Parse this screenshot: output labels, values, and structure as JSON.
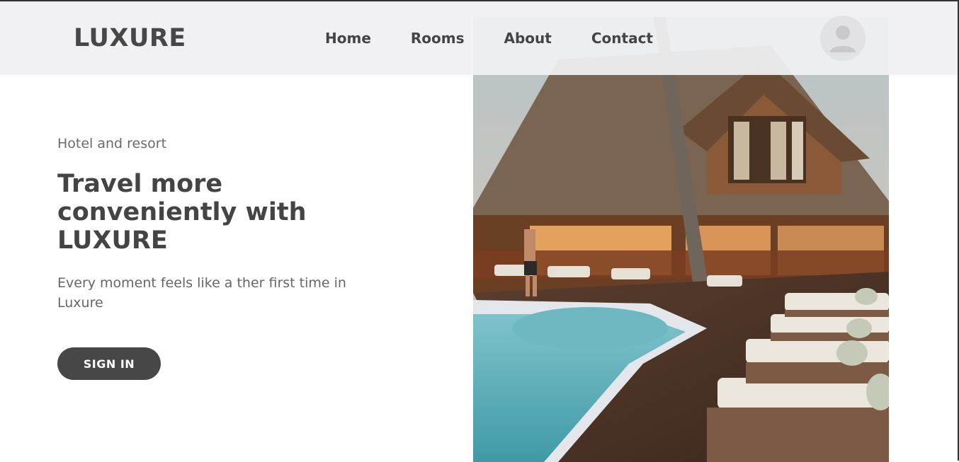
{
  "brand": {
    "logo_text": "LUXURE"
  },
  "nav": {
    "links": [
      {
        "label": "Home"
      },
      {
        "label": "Rooms"
      },
      {
        "label": "About"
      },
      {
        "label": "Contact"
      }
    ],
    "avatar_icon": "user-avatar-icon"
  },
  "hero": {
    "eyebrow": "Hotel and resort",
    "headline": "Travel more conveniently with LUXURE",
    "subtext": "Every moment feels like a ther first time in Luxure",
    "cta_label": "SIGN IN"
  },
  "colors": {
    "accent": "#474747",
    "navbar_bg": "#f0f0f2",
    "text_primary": "#444444",
    "text_muted": "#666666"
  }
}
